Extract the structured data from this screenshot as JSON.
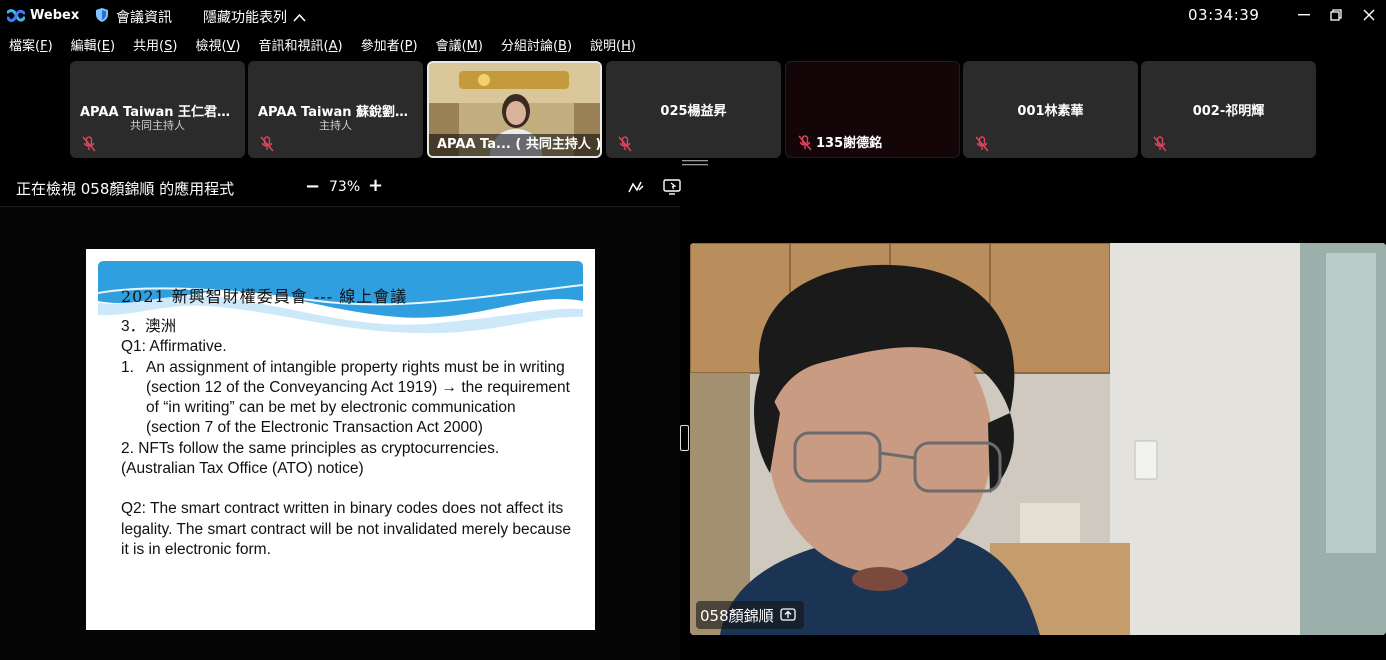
{
  "titlebar": {
    "app_name": "Webex",
    "meeting_info": "會議資訊",
    "hide_menu": "隱藏功能表列",
    "clock": "03:34:39"
  },
  "menu": [
    {
      "label": "檔案(",
      "key": "F",
      "end": ")"
    },
    {
      "label": "編輯(",
      "key": "E",
      "end": ")"
    },
    {
      "label": "共用(",
      "key": "S",
      "end": ")"
    },
    {
      "label": "檢視(",
      "key": "V",
      "end": ")"
    },
    {
      "label": "音訊和視訊(",
      "key": "A",
      "end": ")"
    },
    {
      "label": "參加者(",
      "key": "P",
      "end": ")"
    },
    {
      "label": "會議(",
      "key": "M",
      "end": ")"
    },
    {
      "label": "分組討論(",
      "key": "B",
      "end": ")"
    },
    {
      "label": "說明(",
      "key": "H",
      "end": ")"
    }
  ],
  "participants": [
    {
      "name": "APAA Taiwan 王仁君秘...",
      "role": "共同主持人"
    },
    {
      "name": "APAA Taiwan 蘇銳劉秘...",
      "role": "主持人"
    },
    {
      "name": "APAA Ta... ( 共同主持人 )"
    },
    {
      "name": "025楊益昇"
    },
    {
      "name": "135謝德銘"
    },
    {
      "name": "001林素華"
    },
    {
      "name": "002-祁明輝"
    }
  ],
  "share": {
    "title": "正在檢視 058顏錦順 的應用程式",
    "zoom": "73%"
  },
  "slide": {
    "title": "2021 新興智財權委員會 --- 線上會議",
    "lines": {
      "l1": "3．澳洲",
      "l2": "Q1: Affirmative.",
      "n1": "1.",
      "item1": "An assignment of intangible property rights must be in writing (section 12 of the Conveyancing Act 1919) → the requirement of “in writing” can be met by electronic communication (section 7 of the Electronic Transaction Act 2000)",
      "l3": "2. NFTs follow the same principles as cryptocurrencies.",
      "l4": "(Australian Tax Office (ATO) notice)",
      "l5": "Q2:  The smart contract written in binary codes does not affect its legality.  The smart contract will be not invalidated merely because it is in electronic form."
    }
  },
  "speaker": {
    "name": "058顏錦順"
  },
  "colors": {
    "tile_bg": "#2b2b2b",
    "muted_red": "#e0435a",
    "banner_blue": "#2f9fe0"
  }
}
